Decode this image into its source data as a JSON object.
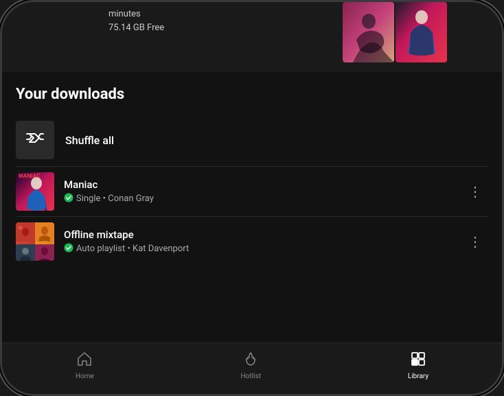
{
  "header": {
    "storage_line1": "minutes",
    "storage_line2": "75.14 GB Free"
  },
  "downloads": {
    "section_title": "Your downloads",
    "shuffle_label": "Shuffle all"
  },
  "tracks": [
    {
      "id": "maniac",
      "title": "Maniac",
      "type": "Single",
      "artist": "Conan Gray",
      "subtitle": "Single • Conan Gray",
      "downloaded": true
    },
    {
      "id": "offline-mixtape",
      "title": "Offline mixtape",
      "type": "Auto playlist",
      "artist": "Kat Davenport",
      "subtitle": "Auto playlist • Kat Davenport",
      "downloaded": true
    }
  ],
  "nav": {
    "items": [
      {
        "id": "home",
        "label": "Home",
        "icon": "home",
        "active": false
      },
      {
        "id": "hotlist",
        "label": "Hotlist",
        "icon": "fire",
        "active": false
      },
      {
        "id": "library",
        "label": "Library",
        "icon": "library",
        "active": true
      }
    ]
  },
  "icons": {
    "shuffle": "⇄",
    "more": "⋮",
    "check": "✓",
    "home": "⌂",
    "fire": "🔥",
    "library": "▦"
  }
}
